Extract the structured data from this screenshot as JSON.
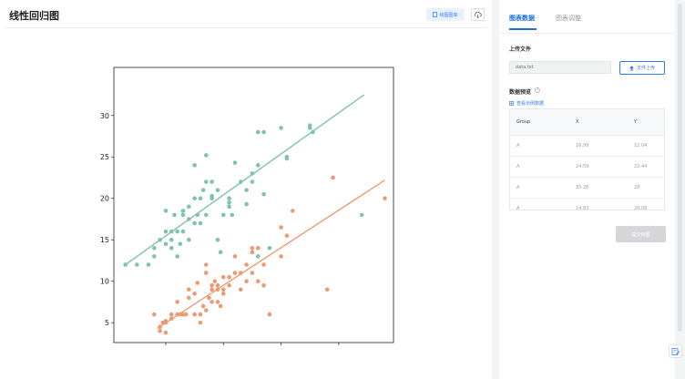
{
  "header": {
    "title": "线性回归图",
    "gallery_button": "绘图图库",
    "download_icon": "cloud-download-icon"
  },
  "tabs": [
    {
      "label": "图表数据",
      "active": true
    },
    {
      "label": "图表调整",
      "active": false
    }
  ],
  "upload": {
    "section_title": "上传文件",
    "file_placeholder": "data.txt",
    "upload_button": "文件上传"
  },
  "preview": {
    "section_title": "数据预览",
    "example_link": "查看示例数据",
    "columns": [
      "Group",
      "X",
      "Y"
    ],
    "rows": [
      [
        "A",
        "16.99",
        "12.04"
      ],
      [
        "A",
        "24.59",
        "22.44"
      ],
      [
        "A",
        "35.26",
        "28"
      ],
      [
        "A",
        "14.83",
        "20.08"
      ]
    ]
  },
  "submit_button": "提交绘图",
  "colors": {
    "accent": "#1a6fe8",
    "series_green": "#7ec4a6",
    "series_orange": "#ec9a72"
  },
  "chart_data": {
    "type": "scatter",
    "xlim": [
      1,
      49.5
    ],
    "ylim": [
      2.6,
      35.8
    ],
    "xticks": [
      10,
      20,
      30,
      40
    ],
    "yticks": [
      5,
      10,
      15,
      20,
      25,
      30
    ],
    "grid": false,
    "legend": "none",
    "series": [
      {
        "color": "#7ec4a6",
        "regression": {
          "x": [
            3,
            44.4
          ],
          "y": [
            12,
            32.5
          ]
        },
        "points": [
          [
            3,
            12
          ],
          [
            5,
            12
          ],
          [
            7,
            12
          ],
          [
            8,
            13
          ],
          [
            8,
            14
          ],
          [
            9,
            15
          ],
          [
            10,
            18.5
          ],
          [
            10,
            16
          ],
          [
            10,
            14.5
          ],
          [
            11,
            16
          ],
          [
            11,
            14
          ],
          [
            11,
            15
          ],
          [
            11.5,
            18
          ],
          [
            12,
            16
          ],
          [
            12,
            13
          ],
          [
            12.5,
            14.5
          ],
          [
            13,
            16
          ],
          [
            13,
            18
          ],
          [
            13,
            18.5
          ],
          [
            14,
            15
          ],
          [
            14,
            17.5
          ],
          [
            14,
            19
          ],
          [
            15,
            24
          ],
          [
            15,
            17
          ],
          [
            15,
            20
          ],
          [
            15.5,
            18
          ],
          [
            16,
            17
          ],
          [
            16,
            20
          ],
          [
            16.5,
            21
          ],
          [
            17,
            25.2
          ],
          [
            17,
            18
          ],
          [
            17,
            22
          ],
          [
            18,
            20
          ],
          [
            18,
            22
          ],
          [
            18,
            20.3
          ],
          [
            19,
            21
          ],
          [
            19,
            15
          ],
          [
            19.5,
            13.5
          ],
          [
            20,
            18
          ],
          [
            21,
            20
          ],
          [
            21,
            19
          ],
          [
            21,
            19.5
          ],
          [
            21.5,
            18
          ],
          [
            22,
            24.3
          ],
          [
            23,
            22
          ],
          [
            24,
            21
          ],
          [
            24,
            19.3
          ],
          [
            25,
            22
          ],
          [
            25,
            23
          ],
          [
            26,
            24
          ],
          [
            26,
            13
          ],
          [
            26,
            28
          ],
          [
            27,
            28
          ],
          [
            27,
            20.5
          ],
          [
            28,
            14
          ],
          [
            30,
            28.5
          ],
          [
            31,
            25
          ],
          [
            31,
            24.8
          ],
          [
            35,
            28.5
          ],
          [
            35,
            28.8
          ],
          [
            35.5,
            28
          ],
          [
            44,
            18
          ]
        ]
      },
      {
        "color": "#ec9a72",
        "regression": {
          "x": [
            8.5,
            48
          ],
          "y": [
            4.3,
            22.2
          ]
        },
        "points": [
          [
            8,
            6
          ],
          [
            9,
            4
          ],
          [
            9,
            4.5
          ],
          [
            9.5,
            5
          ],
          [
            10,
            5
          ],
          [
            10,
            3.8
          ],
          [
            10,
            5.2
          ],
          [
            11,
            6
          ],
          [
            11,
            5.5
          ],
          [
            12,
            6
          ],
          [
            12,
            7.5
          ],
          [
            12.5,
            6
          ],
          [
            13,
            6
          ],
          [
            13,
            6
          ],
          [
            13.5,
            6
          ],
          [
            14,
            9
          ],
          [
            14,
            8
          ],
          [
            15,
            6
          ],
          [
            15,
            8.5
          ],
          [
            15.5,
            9.8
          ],
          [
            16,
            6
          ],
          [
            16,
            5
          ],
          [
            16.5,
            7
          ],
          [
            17,
            6.5
          ],
          [
            17,
            11
          ],
          [
            17,
            12
          ],
          [
            17.5,
            8
          ],
          [
            18,
            7.5
          ],
          [
            18,
            9
          ],
          [
            18,
            9.5
          ],
          [
            18.5,
            10
          ],
          [
            19,
            9.5
          ],
          [
            19,
            9
          ],
          [
            19,
            7.5
          ],
          [
            19.5,
            7
          ],
          [
            20,
            10.5
          ],
          [
            20,
            9
          ],
          [
            20,
            8.5
          ],
          [
            21,
            9.5
          ],
          [
            21,
            10.5
          ],
          [
            22,
            11
          ],
          [
            22,
            13
          ],
          [
            23,
            9
          ],
          [
            23,
            11
          ],
          [
            24,
            12
          ],
          [
            24,
            10
          ],
          [
            25,
            11
          ],
          [
            25,
            14
          ],
          [
            25,
            13.5
          ],
          [
            26,
            10
          ],
          [
            26,
            14
          ],
          [
            27,
            9.5
          ],
          [
            27,
            12
          ],
          [
            28,
            6
          ],
          [
            30,
            16.5
          ],
          [
            30,
            13
          ],
          [
            31,
            15.5
          ],
          [
            32,
            18.5
          ],
          [
            38,
            9
          ],
          [
            39,
            22.5
          ],
          [
            48,
            20
          ]
        ]
      }
    ]
  }
}
